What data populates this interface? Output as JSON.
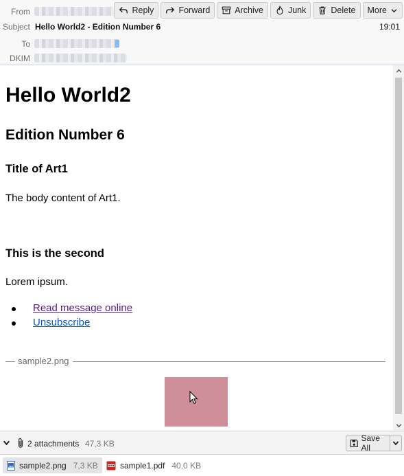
{
  "header": {
    "from_label": "From",
    "subject_label": "Subject",
    "subject": "Hello World2 - Edition Number 6",
    "time": "19:01",
    "to_label": "To",
    "dkim_label": "DKIM"
  },
  "toolbar": {
    "reply": "Reply",
    "forward": "Forward",
    "archive": "Archive",
    "junk": "Junk",
    "delete": "Delete",
    "more": "More"
  },
  "message": {
    "h1": "Hello World2",
    "h2": "Edition Number 6",
    "article1_title": "Title of Art1",
    "article1_body": "The body content of Art1.",
    "article2_title": "This is the second",
    "article2_body": "Lorem ipsum.",
    "links": [
      "Read message online",
      "Unsubscribe"
    ],
    "inline_attachment_name": "sample2.png"
  },
  "attachments_bar": {
    "count": "2 attachments",
    "total_size": "47,3 KB",
    "save_all": "Save All"
  },
  "attachments": [
    {
      "name": "sample2.png",
      "size": "7,3 KB",
      "icon": "image-file-icon"
    },
    {
      "name": "sample1.pdf",
      "size": "40,0 KB",
      "icon": "pdf-file-icon"
    }
  ],
  "colors": {
    "thumbnail": "#cf8f9a",
    "visited_link": "#551a8b",
    "link": "#0b57d0"
  }
}
